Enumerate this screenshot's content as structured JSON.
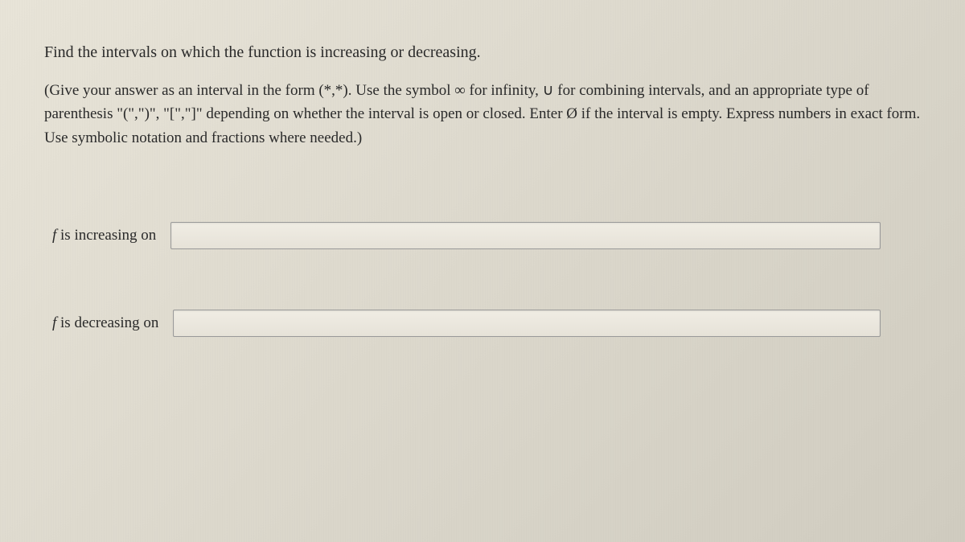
{
  "question": "Find the intervals on which the function is increasing or decreasing.",
  "instructions": "(Give your answer as an interval in the form (*,*). Use the symbol ∞ for infinity, ∪ for combining intervals, and an appropriate type of parenthesis \"(\",\")\", \"[\",\"]\" depending on whether the interval is open or closed. Enter Ø if the interval is empty. Express numbers in exact form. Use symbolic notation and fractions where needed.)",
  "answers": {
    "increasing": {
      "label_prefix": "f",
      "label_text": " is increasing on",
      "value": ""
    },
    "decreasing": {
      "label_prefix": "f",
      "label_text": " is decreasing on",
      "value": ""
    }
  }
}
